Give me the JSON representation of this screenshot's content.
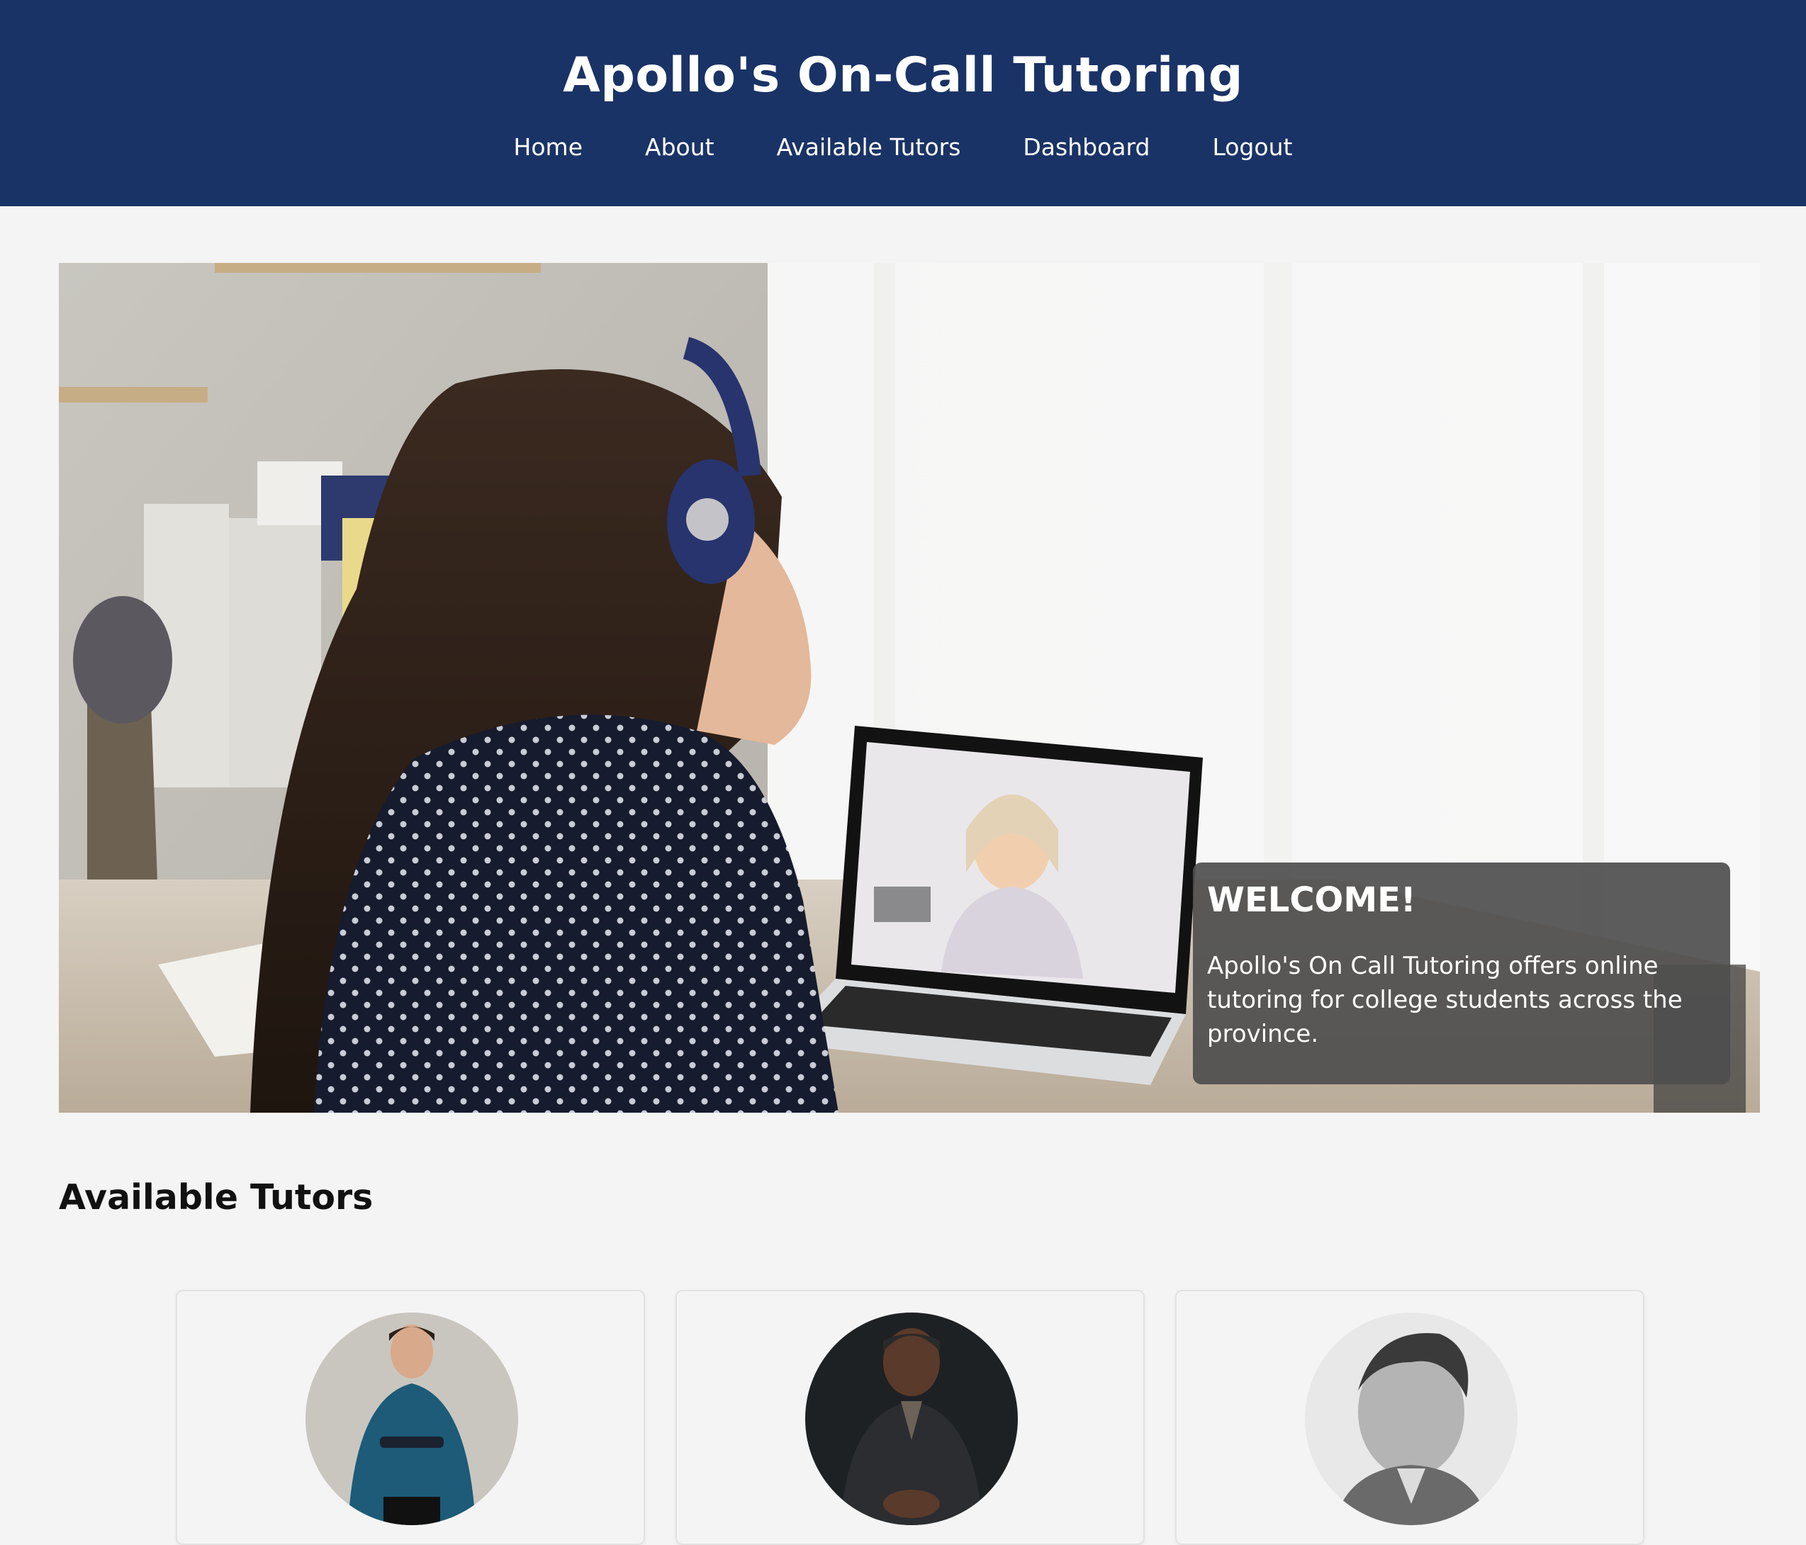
{
  "header": {
    "title": "Apollo's On-Call Tutoring",
    "nav": [
      "Home",
      "About",
      "Available Tutors",
      "Dashboard",
      "Logout"
    ]
  },
  "hero": {
    "welcome_title": "WELCOME!",
    "welcome_text": "Apollo's On Call Tutoring offers online tutoring for college students across the province."
  },
  "tutors_section": {
    "title": "Available Tutors",
    "tutors": [
      {
        "photo": "tutor-photo-woman-teal-shirt"
      },
      {
        "photo": "tutor-photo-man-dark-jacket"
      },
      {
        "photo": "tutor-photo-man-bw-portrait"
      }
    ]
  },
  "colors": {
    "header_bg": "#1a3366",
    "page_bg": "#f4f4f4",
    "card_overlay": "#4e4e4e"
  }
}
